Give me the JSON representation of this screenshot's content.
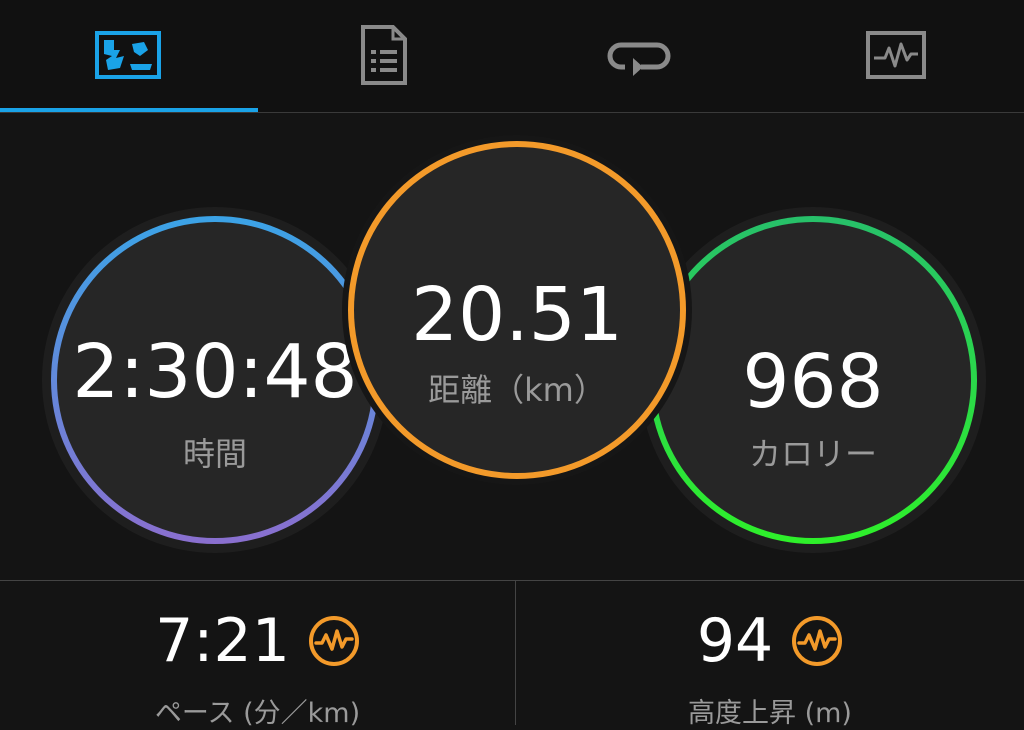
{
  "tabs": [
    {
      "icon": "activity-map-icon",
      "active": true
    },
    {
      "icon": "stats-document-icon",
      "active": false
    },
    {
      "icon": "laps-loop-icon",
      "active": false
    },
    {
      "icon": "chart-monitor-icon",
      "active": false
    }
  ],
  "colors": {
    "accent_blue": "#1aa3e8",
    "time_ring": [
      "#3ba3e6",
      "#8a6fcf"
    ],
    "distance_ring": "#f39a2a",
    "calories_ring": [
      "#27c06a",
      "#2ef02a"
    ],
    "stat_icon": "#f39a2a"
  },
  "summary": {
    "time": {
      "value": "2:30:48",
      "label": "時間"
    },
    "distance": {
      "value": "20.51",
      "label": "距離（km）"
    },
    "calories": {
      "value": "968",
      "label": "カロリー"
    }
  },
  "stats": {
    "pace": {
      "value": "7:21",
      "label": "ペース (分／km)",
      "icon": "pulse-chart-icon"
    },
    "elevation": {
      "value": "94",
      "label": "高度上昇 (m)",
      "icon": "pulse-chart-icon"
    }
  }
}
